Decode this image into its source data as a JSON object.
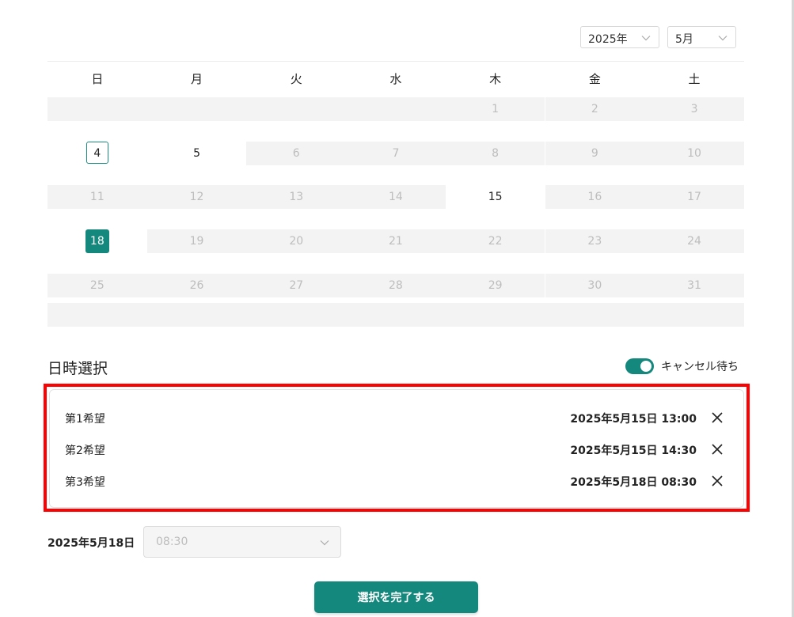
{
  "header": {
    "year_select": {
      "value": "2025年"
    },
    "month_select": {
      "value": "5月"
    }
  },
  "calendar": {
    "weekdays": [
      "日",
      "月",
      "火",
      "水",
      "木",
      "金",
      "土"
    ],
    "weeks": [
      [
        {
          "day": "",
          "state": "grey"
        },
        {
          "day": "",
          "state": "grey"
        },
        {
          "day": "",
          "state": "grey"
        },
        {
          "day": "",
          "state": "grey"
        },
        {
          "day": "1",
          "state": "grey"
        },
        {
          "day": "2",
          "state": "grey"
        },
        {
          "day": "3",
          "state": "grey"
        }
      ],
      [
        {
          "day": "4",
          "state": "today"
        },
        {
          "day": "5",
          "state": "available"
        },
        {
          "day": "6",
          "state": "grey"
        },
        {
          "day": "7",
          "state": "grey"
        },
        {
          "day": "8",
          "state": "grey"
        },
        {
          "day": "9",
          "state": "grey"
        },
        {
          "day": "10",
          "state": "grey"
        }
      ],
      [
        {
          "day": "11",
          "state": "grey"
        },
        {
          "day": "12",
          "state": "grey"
        },
        {
          "day": "13",
          "state": "grey"
        },
        {
          "day": "14",
          "state": "grey"
        },
        {
          "day": "15",
          "state": "available"
        },
        {
          "day": "16",
          "state": "grey"
        },
        {
          "day": "17",
          "state": "grey"
        }
      ],
      [
        {
          "day": "18",
          "state": "selected"
        },
        {
          "day": "19",
          "state": "grey"
        },
        {
          "day": "20",
          "state": "grey"
        },
        {
          "day": "21",
          "state": "grey"
        },
        {
          "day": "22",
          "state": "grey"
        },
        {
          "day": "23",
          "state": "grey"
        },
        {
          "day": "24",
          "state": "grey"
        }
      ],
      [
        {
          "day": "25",
          "state": "grey"
        },
        {
          "day": "26",
          "state": "grey"
        },
        {
          "day": "27",
          "state": "grey"
        },
        {
          "day": "28",
          "state": "grey"
        },
        {
          "day": "29",
          "state": "grey"
        },
        {
          "day": "30",
          "state": "grey"
        },
        {
          "day": "31",
          "state": "grey"
        }
      ]
    ]
  },
  "section": {
    "title": "日時選択",
    "toggle_label": "キャンセル待ち",
    "toggle_on": true
  },
  "preferences": [
    {
      "label": "第1希望",
      "value": "2025年5月15日 13:00"
    },
    {
      "label": "第2希望",
      "value": "2025年5月15日 14:30"
    },
    {
      "label": "第3希望",
      "value": "2025年5月18日 08:30"
    }
  ],
  "time_selection": {
    "date_label": "2025年5月18日",
    "time_value": "08:30"
  },
  "complete_button": {
    "label": "選択を完了する"
  },
  "colors": {
    "accent": "#14887c",
    "highlight": "#ff0000",
    "grey_cell": "#f3f3f3"
  },
  "icons": {
    "dropdown": "chevron-down-icon",
    "remove": "close-icon"
  }
}
